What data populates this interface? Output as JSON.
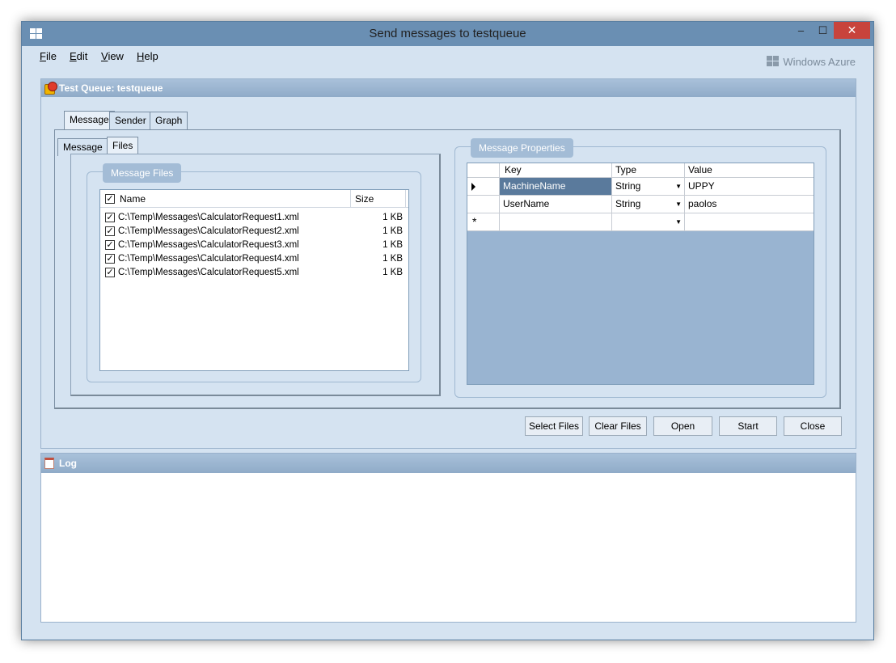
{
  "window": {
    "title": "Send messages to testqueue",
    "controls": {
      "minimize": "–",
      "maximize": "☐",
      "close": "✕"
    }
  },
  "menu": {
    "items": [
      {
        "label": "File"
      },
      {
        "label": "Edit"
      },
      {
        "label": "View"
      },
      {
        "label": "Help"
      }
    ],
    "brand": "Windows Azure"
  },
  "main_panel": {
    "title": "Test Queue: testqueue",
    "tabs": [
      {
        "label": "Message",
        "active": true
      },
      {
        "label": "Sender",
        "active": false
      },
      {
        "label": "Graph",
        "active": false
      }
    ],
    "inner_tabs": [
      {
        "label": "Message",
        "active": false
      },
      {
        "label": "Files",
        "active": true
      }
    ],
    "message_files": {
      "group_label": "Message Files",
      "columns": {
        "name": "Name",
        "size": "Size"
      },
      "files": [
        {
          "path": "C:\\Temp\\Messages\\CalculatorRequest1.xml",
          "size": "1 KB",
          "checked": true
        },
        {
          "path": "C:\\Temp\\Messages\\CalculatorRequest2.xml",
          "size": "1 KB",
          "checked": true
        },
        {
          "path": "C:\\Temp\\Messages\\CalculatorRequest3.xml",
          "size": "1 KB",
          "checked": true
        },
        {
          "path": "C:\\Temp\\Messages\\CalculatorRequest4.xml",
          "size": "1 KB",
          "checked": true
        },
        {
          "path": "C:\\Temp\\Messages\\CalculatorRequest5.xml",
          "size": "1 KB",
          "checked": true
        }
      ]
    },
    "message_properties": {
      "group_label": "Message Properties",
      "columns": {
        "key": "Key",
        "type": "Type",
        "value": "Value"
      },
      "rows": [
        {
          "key": "MachineName",
          "type": "String",
          "value": "UPPY",
          "selected": true
        },
        {
          "key": "UserName",
          "type": "String",
          "value": "paolos",
          "selected": false
        }
      ]
    },
    "buttons": {
      "select_files": "Select Files",
      "clear_files": "Clear Files",
      "open": "Open",
      "start": "Start",
      "close": "Close"
    }
  },
  "log_panel": {
    "title": "Log"
  }
}
